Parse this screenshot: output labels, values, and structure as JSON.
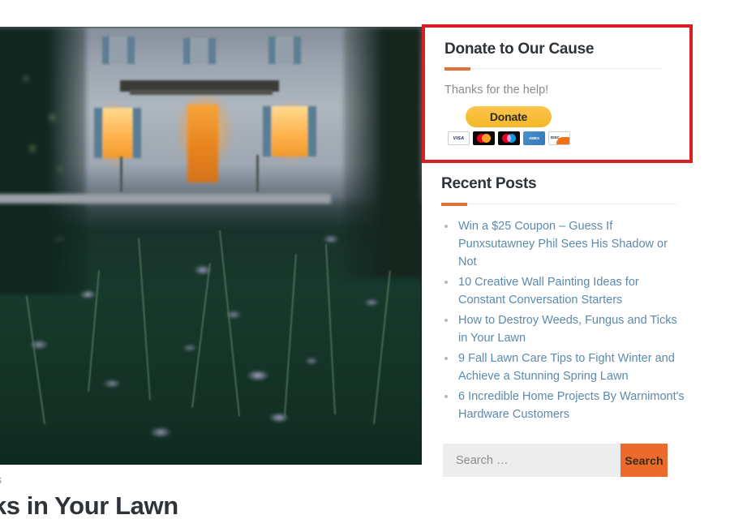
{
  "article": {
    "hero_image_alt": "house-at-dusk-with-wildflower-meadow",
    "meta": "omments",
    "title": "Fungus and Ticks in Your Lawn"
  },
  "sidebar": {
    "donate_widget": {
      "title": "Donate to Our Cause",
      "thanks_text": "Thanks for the help!",
      "donate_button_label": "Donate",
      "accent_color": "#e2703a",
      "highlight_border_color": "#d81f22",
      "cards": [
        {
          "name": "visa-card-icon",
          "label": "VISA"
        },
        {
          "name": "mastercard-card-icon",
          "label": ""
        },
        {
          "name": "maestro-card-icon",
          "label": ""
        },
        {
          "name": "amex-card-icon",
          "label": "AMERICAN EXPRESS"
        },
        {
          "name": "discover-card-icon",
          "label": "DISCOVER"
        }
      ]
    },
    "recent_posts_widget": {
      "title": "Recent Posts",
      "accent_color": "#e2703a",
      "link_color": "#5b8aad",
      "posts": [
        "Win a $25 Coupon – Guess If Punxsutawney Phil Sees His Shadow or Not",
        "10 Creative Wall Painting Ideas for Constant Conversation Starters",
        "How to Destroy Weeds, Fungus and Ticks in Your Lawn",
        "9 Fall Lawn Care Tips to Fight Winter and Achieve a Stunning Spring Lawn",
        "6 Incredible Home Projects By Warnimont's Hardware Customers"
      ]
    },
    "search_widget": {
      "placeholder": "Search …",
      "value": "",
      "button_label": "Search",
      "button_color": "#ec6a2c",
      "field_color": "#ededed"
    }
  }
}
